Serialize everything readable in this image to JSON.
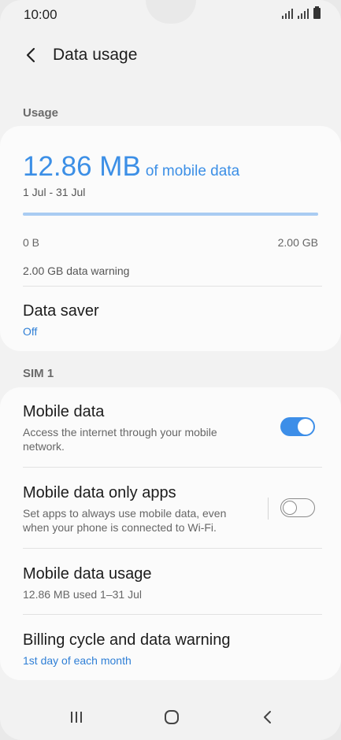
{
  "status": {
    "time": "10:00"
  },
  "header": {
    "title": "Data usage"
  },
  "usage_section": {
    "label": "Usage",
    "amount": "12.86 MB",
    "amount_suffix": "of mobile data",
    "range": "1 Jul - 31 Jul",
    "progress_fraction": 0.006,
    "axis_min": "0 B",
    "axis_max": "2.00 GB",
    "warning": "2.00 GB data warning",
    "data_saver": {
      "title": "Data saver",
      "value": "Off"
    }
  },
  "sim_section": {
    "label": "SIM 1",
    "items": [
      {
        "title": "Mobile data",
        "subtitle": "Access the internet through your mobile network.",
        "toggle": "on"
      },
      {
        "title": "Mobile data only apps",
        "subtitle": "Set apps to always use mobile data, even when your phone is connected to Wi-Fi.",
        "toggle": "off"
      },
      {
        "title": "Mobile data usage",
        "subtitle": "12.86 MB used 1–31 Jul"
      },
      {
        "title": "Billing cycle and data warning",
        "subtitle": "1st day of each month"
      }
    ]
  },
  "colors": {
    "accent": "#3d8ee8",
    "link": "#2f7fd6"
  },
  "nav": {
    "icons": [
      "recent-apps-icon",
      "home-icon",
      "back-icon"
    ]
  }
}
